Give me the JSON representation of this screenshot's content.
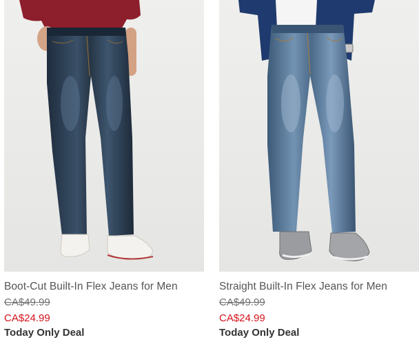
{
  "products": [
    {
      "title": "Boot-Cut Built-In Flex Jeans for Men",
      "original_price": "CA$49.99",
      "sale_price": "CA$24.99",
      "deal_label": "Today Only Deal",
      "image_icon": "jeans-product-photo"
    },
    {
      "title": "Straight Built-In Flex Jeans for Men",
      "original_price": "CA$49.99",
      "sale_price": "CA$24.99",
      "deal_label": "Today Only Deal",
      "image_icon": "jeans-product-photo"
    }
  ],
  "colors": {
    "sale_red": "#d1121a",
    "photo_background": "#ececea",
    "dark_denim": "#2c3e52",
    "medium_denim": "#5a7b9c"
  }
}
